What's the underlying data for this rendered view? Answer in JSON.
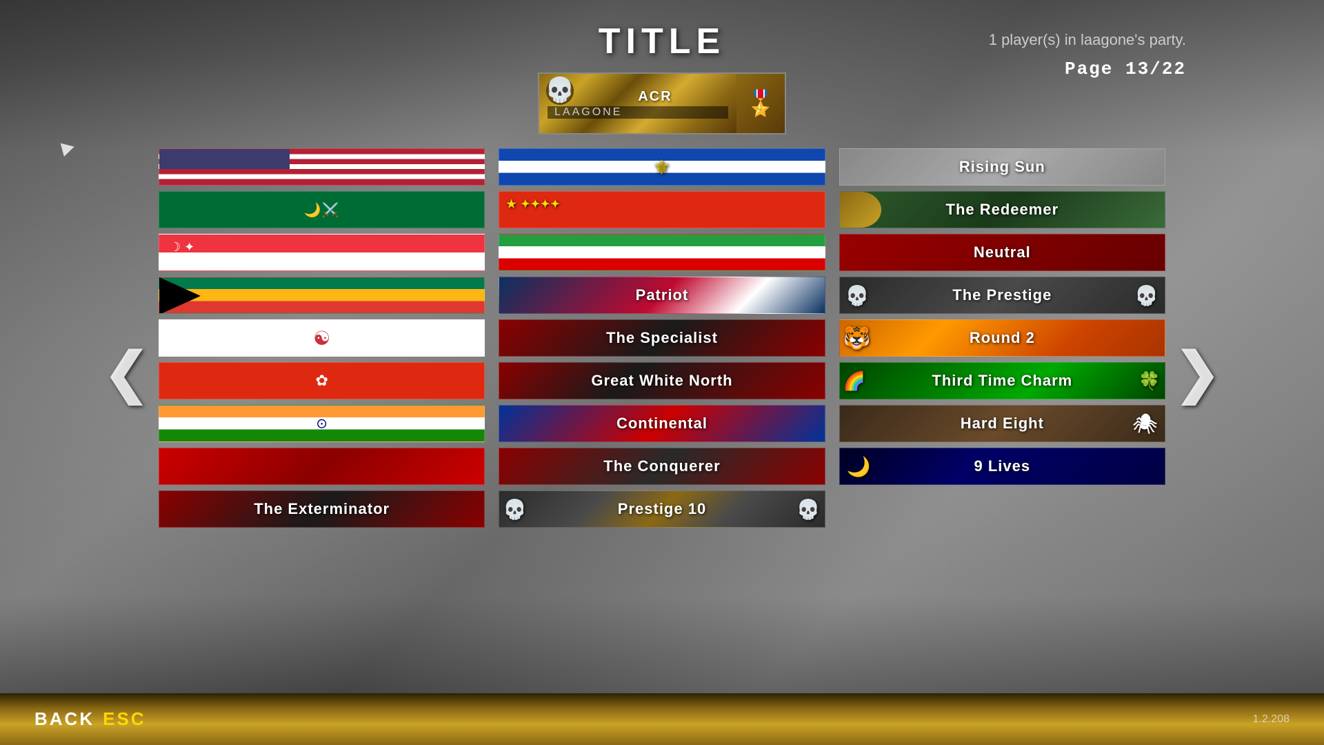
{
  "header": {
    "title": "TITLE",
    "party_info": "1 player(s) in laagone's party.",
    "page_number": "Page 13/22"
  },
  "player_card": {
    "acr_label": "ACR",
    "player_name": "LAAGONE"
  },
  "nav": {
    "arrow_left": "❮",
    "arrow_right": "❯"
  },
  "left_column": {
    "items": [
      {
        "id": "flag-us",
        "type": "usa"
      },
      {
        "id": "flag-sa",
        "type": "saudi"
      },
      {
        "id": "flag-sg",
        "type": "sg"
      },
      {
        "id": "flag-za",
        "type": "za"
      },
      {
        "id": "flag-kr",
        "type": "kr"
      },
      {
        "id": "flag-hk",
        "type": "hk"
      },
      {
        "id": "flag-in",
        "type": "india"
      },
      {
        "id": "flag-it",
        "type": "generic-red"
      }
    ]
  },
  "middle_column": {
    "items": [
      {
        "id": "title-el-salvador",
        "label": "",
        "style": "flag-el-salvador"
      },
      {
        "id": "title-china",
        "label": "",
        "style": "flag-china"
      },
      {
        "id": "title-iran",
        "label": "",
        "style": "flag-iran"
      },
      {
        "id": "title-patriot",
        "label": "Patriot",
        "style": "patriot"
      },
      {
        "id": "title-specialist",
        "label": "The Specialist",
        "style": "specialist"
      },
      {
        "id": "title-gwn",
        "label": "Great White North",
        "style": "gwn"
      },
      {
        "id": "title-continental",
        "label": "Continental",
        "style": "continental"
      },
      {
        "id": "title-conquerer",
        "label": "The Conquerer",
        "style": "conquerer"
      },
      {
        "id": "title-exterminator",
        "label": "The Exterminator",
        "style": "exterminator"
      }
    ]
  },
  "right_column": {
    "items": [
      {
        "id": "rising-sun",
        "label": "Rising Sun",
        "style": "rising-sun"
      },
      {
        "id": "redeemer",
        "label": "The Redeemer",
        "style": "redeemer"
      },
      {
        "id": "neutral",
        "label": "Neutral",
        "style": "neutral"
      },
      {
        "id": "prestige",
        "label": "The Prestige",
        "style": "prestige"
      },
      {
        "id": "round2",
        "label": "Round 2",
        "style": "round2"
      },
      {
        "id": "third-time",
        "label": "Third Time Charm",
        "style": "third-time"
      },
      {
        "id": "hard-eight",
        "label": "Hard Eight",
        "style": "hard-eight"
      },
      {
        "id": "9lives",
        "label": "9 Lives",
        "style": "9lives"
      },
      {
        "id": "prestige10",
        "label": "Prestige 10",
        "style": "prestige10"
      }
    ]
  },
  "footer": {
    "back_label": "BACK",
    "back_key": "ESC",
    "version": "1.2.208"
  }
}
